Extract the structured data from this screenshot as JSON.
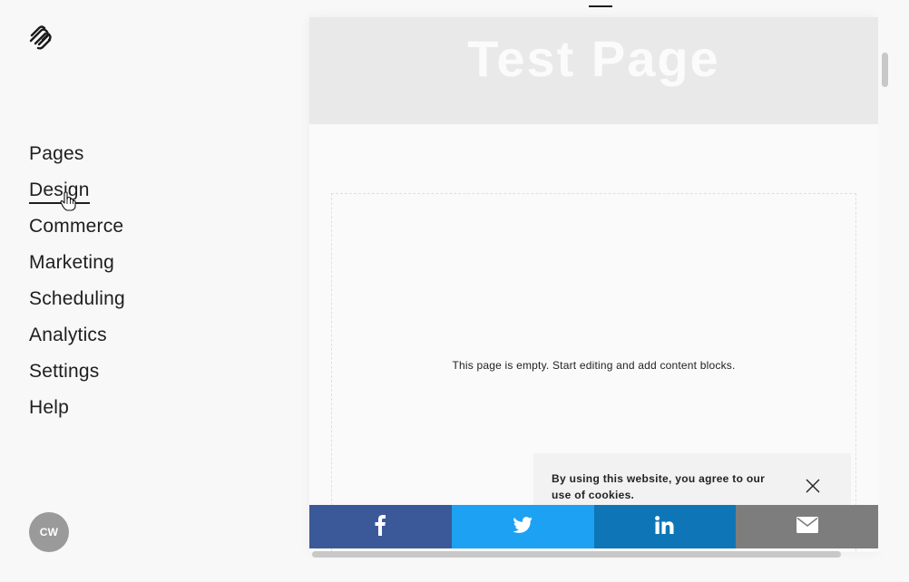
{
  "sidebar": {
    "logo_icon": "squarespace-logo-icon",
    "nav": [
      {
        "label": "Pages"
      },
      {
        "label": "Design",
        "active": true
      },
      {
        "label": "Commerce"
      },
      {
        "label": "Marketing"
      },
      {
        "label": "Scheduling"
      },
      {
        "label": "Analytics"
      },
      {
        "label": "Settings"
      },
      {
        "label": "Help"
      }
    ],
    "avatar_initials": "CW"
  },
  "preview": {
    "hero_title": "Test Page",
    "empty_message": "This page is empty. Start editing and add content blocks.",
    "cookie_banner": {
      "text": "By using this website, you agree to our use of cookies.",
      "close_icon": "close-icon"
    },
    "share_buttons": [
      {
        "icon": "facebook-icon",
        "color": "#3b5998"
      },
      {
        "icon": "twitter-icon",
        "color": "#1da1f2"
      },
      {
        "icon": "linkedin-icon",
        "color": "#0e76b6"
      },
      {
        "icon": "email-icon",
        "color": "#7d7d7d"
      }
    ]
  }
}
